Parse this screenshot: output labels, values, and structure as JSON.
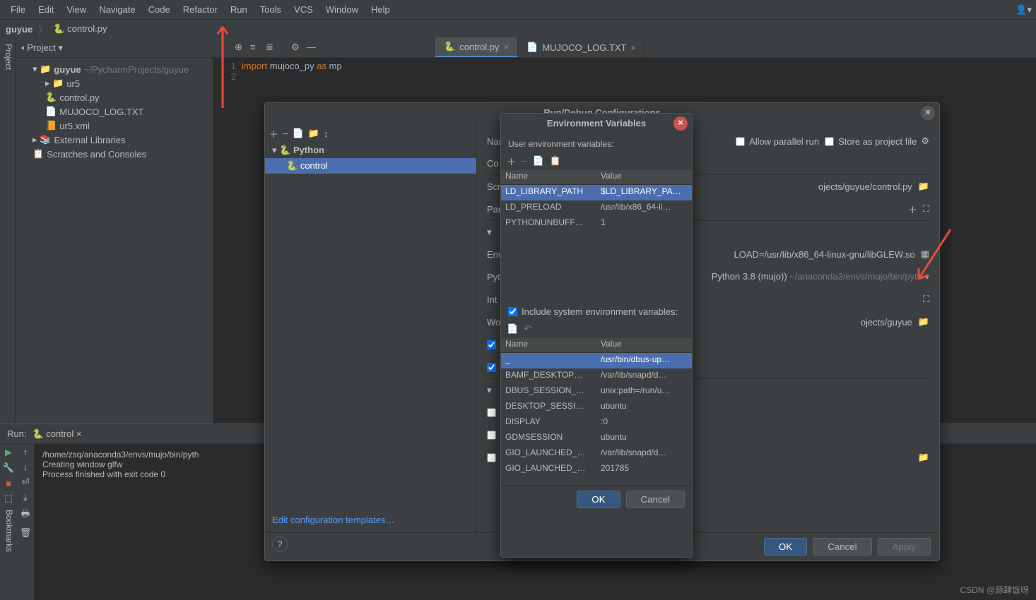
{
  "menubar": [
    "File",
    "Edit",
    "View",
    "Navigate",
    "Code",
    "Refactor",
    "Run",
    "Tools",
    "VCS",
    "Window",
    "Help"
  ],
  "breadcrumb": {
    "project": "guyue",
    "file": "control.py"
  },
  "project_panel": {
    "title": "Project"
  },
  "tree": {
    "root": "guyue",
    "root_path": "~/PycharmProjects/guyue",
    "children": [
      {
        "name": "ur5",
        "type": "folder"
      },
      {
        "name": "control.py",
        "type": "py"
      },
      {
        "name": "MUJOCO_LOG.TXT",
        "type": "txt"
      },
      {
        "name": "ur5.xml",
        "type": "xml"
      }
    ],
    "external": "External Libraries",
    "scratches": "Scratches and Consoles"
  },
  "tabs": [
    {
      "name": "control.py",
      "active": true
    },
    {
      "name": "MUJOCO_LOG.TXT",
      "active": false
    }
  ],
  "code": {
    "line1": {
      "num": "1",
      "text_import": "import",
      "text_module": "mujoco_py",
      "text_as": "as",
      "text_alias": "mp"
    },
    "line2": {
      "num": "2"
    }
  },
  "run": {
    "label": "Run:",
    "config": "control",
    "output": [
      "/home/zsq/anaconda3/envs/mujo/bin/pyth",
      "Creating window glfw",
      "",
      "Process finished with exit code 0"
    ]
  },
  "sidetabs": {
    "project": "Project",
    "bookmarks": "Bookmarks"
  },
  "dialog1": {
    "title": "Run/Debug Configurations",
    "tree_python": "Python",
    "tree_control": "control",
    "name_label": "Nam",
    "allow_parallel": "Allow parallel run",
    "store_project": "Store as project file",
    "tabs_label": "Co",
    "script_label": "Scr",
    "script_value": "ojects/guyue/control.py",
    "params_label": "Par",
    "env_label": "Env",
    "env_value": "LOAD=/usr/lib/x86_64-linux-gnu/libGLEW.so",
    "python_label": "Pyt",
    "python_value": "Python 3.8 (mujo))",
    "python_path": "~/anaconda3/envs/mujo/bin/pyth",
    "interp_label": "Int",
    "workdir_label": "Wor",
    "workdir_value": "ojects/guyue",
    "edit_templates": "Edit configuration templates…",
    "ok": "OK",
    "cancel": "Cancel",
    "apply": "Apply"
  },
  "dialog2": {
    "title": "Environment Variables",
    "user_label": "User environment variables:",
    "col_name": "Name",
    "col_value": "Value",
    "user_vars": [
      {
        "name": "LD_LIBRARY_PATH",
        "value": "$LD_LIBRARY_PA…"
      },
      {
        "name": "LD_PRELOAD",
        "value": "/usr/lib/x86_64-li…"
      },
      {
        "name": "PYTHONUNBUFF…",
        "value": "1"
      }
    ],
    "include_system": "Include system environment variables:",
    "sys_vars": [
      {
        "name": "_",
        "value": "/usr/bin/dbus-up…"
      },
      {
        "name": "BAMF_DESKTOP…",
        "value": "/var/lib/snapd/d…"
      },
      {
        "name": "DBUS_SESSION_…",
        "value": "unix:path=/run/u…"
      },
      {
        "name": "DESKTOP_SESSI…",
        "value": "ubuntu"
      },
      {
        "name": "DISPLAY",
        "value": ":0"
      },
      {
        "name": "GDMSESSION",
        "value": "ubuntu"
      },
      {
        "name": "GIO_LAUNCHED_…",
        "value": "/var/lib/snapd/d…"
      },
      {
        "name": "GIO_LAUNCHED_…",
        "value": "201785"
      }
    ],
    "ok": "OK",
    "cancel": "Cancel"
  },
  "watermark": "CSDN @蒜肆饭呀"
}
